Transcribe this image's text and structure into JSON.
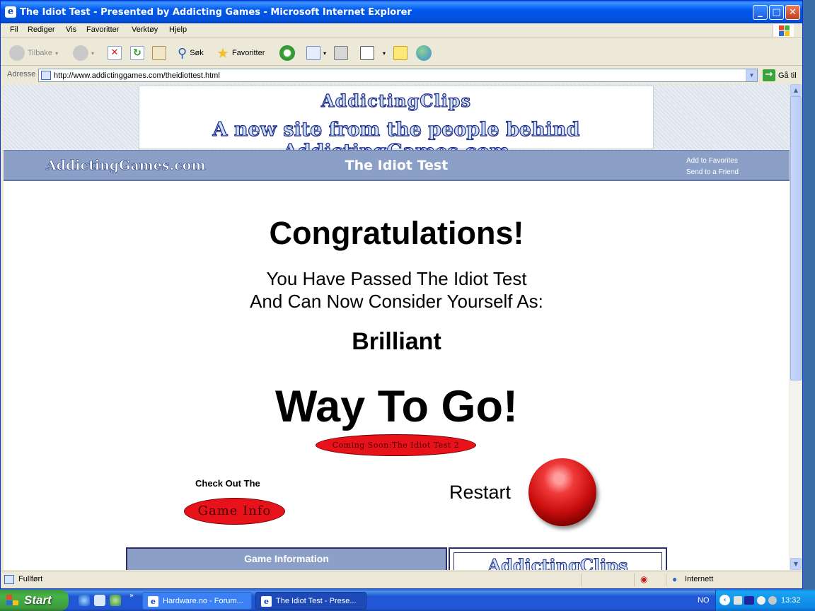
{
  "window": {
    "title": "The Idiot Test - Presented by Addicting Games - Microsoft Internet Explorer",
    "controls": {
      "minimize": "_",
      "maximize": "□",
      "close": "✕"
    }
  },
  "menu": [
    "Fil",
    "Rediger",
    "Vis",
    "Favoritter",
    "Verktøy",
    "Hjelp"
  ],
  "toolbar": {
    "back_label": "Tilbake",
    "search_label": "Søk",
    "favorites_label": "Favoritter"
  },
  "address": {
    "label": "Adresse",
    "url": "http://www.addictinggames.com/theidiottest.html",
    "go_label": "Gå til"
  },
  "page": {
    "banner_brand": "AddictingClips",
    "banner_tagline": "A new site from the people behind AddictingGames.com",
    "site_logo": "AddictingGames.com",
    "game_title": "The Idiot Test",
    "add_favorites": "Add to Favorites",
    "send_friend": "Send to a Friend",
    "congrats": "Congratulations!",
    "passed_line1": "You Have Passed The Idiot Test",
    "passed_line2": "And Can Now Consider Yourself As:",
    "level": "Brilliant",
    "way_to_go": "Way To Go!",
    "coming_soon": "Coming Soon:The Idiot Test 2",
    "check_out": "Check Out The",
    "game_info_btn": "Game Info",
    "restart_label": "Restart",
    "game_information_header": "Game Information",
    "clips_brand": "AddictingClips"
  },
  "status": {
    "text": "Fullført",
    "zone": "Internett"
  },
  "taskbar": {
    "start": "Start",
    "items": [
      "Hardware.no - Forum...",
      "The Idiot Test - Prese..."
    ],
    "lang": "NO",
    "clock": "13:32"
  },
  "colors": {
    "nav_band": "#8c9fc7",
    "oval_red": "#e8121a",
    "xp_blue": "#0058ee"
  }
}
